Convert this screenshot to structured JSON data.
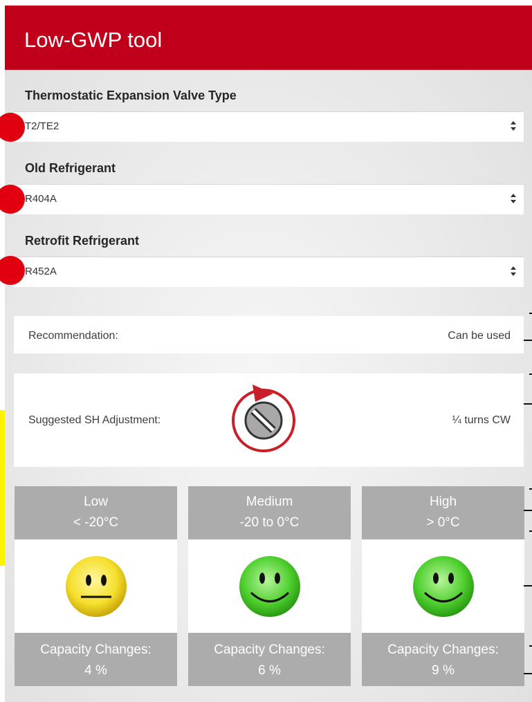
{
  "header": {
    "title": "Low-GWP tool"
  },
  "fields": [
    {
      "label": "Thermostatic Expansion Valve Type",
      "value": "T2/TE2",
      "arrow_icon": "select-arrows-icon"
    },
    {
      "label": "Old Refrigerant",
      "value": "R404A",
      "arrow_icon": "select-arrows-icon"
    },
    {
      "label": "Retrofit Refrigerant",
      "value": "R452A",
      "arrow_icon": "select-arrows-icon"
    }
  ],
  "recommendation": {
    "label": "Recommendation:",
    "value": "Can be used"
  },
  "sh_adjustment": {
    "label": "Suggested SH Adjustment:",
    "value": "¼ turns CW",
    "icon": "screw-rotate-cw-icon"
  },
  "ranges": [
    {
      "name": "Low",
      "range": "< -20°C",
      "status": "neutral",
      "face_color": "#f5df2c",
      "capacity_label": "Capacity Changes:",
      "capacity_value": "4 %"
    },
    {
      "name": "Medium",
      "range": "-20 to 0°C",
      "status": "good",
      "face_color": "#4fcf2f",
      "capacity_label": "Capacity Changes:",
      "capacity_value": "6 %"
    },
    {
      "name": "High",
      "range": "> 0°C",
      "status": "good",
      "face_color": "#4fcf2f",
      "capacity_label": "Capacity Changes:",
      "capacity_value": "9 %"
    }
  ],
  "colors": {
    "brand": "#c0001a",
    "header_text": "#ffffff",
    "tile_gray": "#acacac",
    "bullet_red": "#e00010",
    "highlight_yellow": "#fff200"
  }
}
